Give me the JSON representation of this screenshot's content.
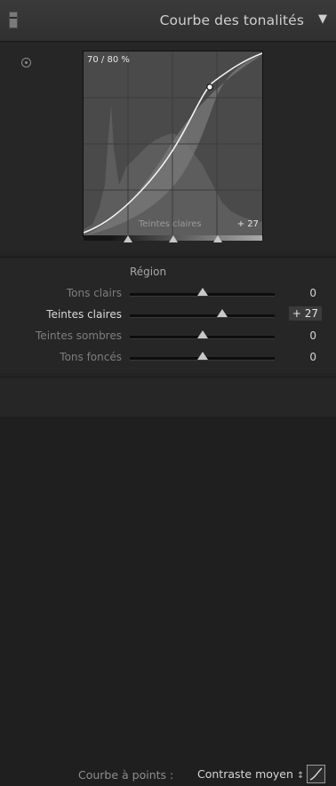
{
  "header": {
    "title": "Courbe des tonalités",
    "grip_icon": "panel-grip-icon",
    "collapse_icon": "triangle-down-icon"
  },
  "curve": {
    "percent_readout": "70 / 80 %",
    "hover_region_label": "Teintes claires",
    "hover_region_value": "+ 27",
    "target_tool_icon": "targeted-adjustment-icon",
    "split_points": [
      0.25,
      0.5,
      0.75
    ]
  },
  "regions": {
    "title": "Région",
    "rows": [
      {
        "label": "Tons clairs",
        "value": "0",
        "level": 0.5,
        "active": false
      },
      {
        "label": "Teintes claires",
        "value": "+ 27",
        "level": 0.64,
        "active": true
      },
      {
        "label": "Teintes sombres",
        "value": "0",
        "level": 0.5,
        "active": false
      },
      {
        "label": "Tons foncés",
        "value": "0",
        "level": 0.5,
        "active": false
      }
    ]
  },
  "point_curve": {
    "label": "Courbe à points :",
    "selected": "Contraste moyen",
    "caret_glyph": "↕",
    "edit_icon": "point-curve-edit-icon"
  },
  "colors": {
    "panel_bg": "#262626",
    "header_bg": "#333333",
    "text": "#b9b9b9",
    "highlight": "#e6e6e6"
  }
}
